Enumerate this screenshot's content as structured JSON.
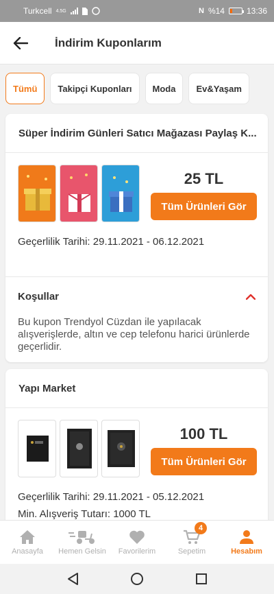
{
  "status": {
    "carrier": "Turkcell",
    "network": "4.5G",
    "battery": "%14",
    "time": "13:36"
  },
  "header": {
    "title": "İndirim Kuponlarım"
  },
  "chips": [
    {
      "label": "Tümü",
      "active": true
    },
    {
      "label": "Takipçi Kuponları",
      "active": false
    },
    {
      "label": "Moda",
      "active": false
    },
    {
      "label": "Ev&Yaşam",
      "active": false
    }
  ],
  "coupons": [
    {
      "title": "Süper İndirim Günleri Satıcı Mağazası Paylaş K...",
      "amount": "25 TL",
      "button": "Tüm Ürünleri Gör",
      "validity": "Geçerlilik Tarihi: 29.11.2021 - 06.12.2021",
      "conditions_label": "Koşullar",
      "conditions_text": "Bu kupon Trendyol Cüzdan ile yapılacak alışverişlerde, altın ve cep telefonu harici ürünlerde geçerlidir."
    },
    {
      "title": "Yapı Market",
      "amount": "100 TL",
      "button": "Tüm Ürünleri Gör",
      "validity": "Geçerlilik Tarihi: 29.11.2021 - 05.12.2021",
      "min_purchase": "Min. Alışveriş Tutarı: 1000 TL"
    }
  ],
  "bottom_nav": [
    {
      "label": "Anasayfa",
      "icon": "home-icon"
    },
    {
      "label": "Hemen Gelsin",
      "icon": "scooter-icon"
    },
    {
      "label": "Favorilerim",
      "icon": "heart-icon"
    },
    {
      "label": "Sepetim",
      "icon": "cart-icon",
      "badge": "4"
    },
    {
      "label": "Hesabım",
      "icon": "user-icon",
      "active": true
    }
  ],
  "colors": {
    "accent": "#f27a1a",
    "inactive_nav": "#b0b0b0",
    "status_bar": "#999999"
  }
}
